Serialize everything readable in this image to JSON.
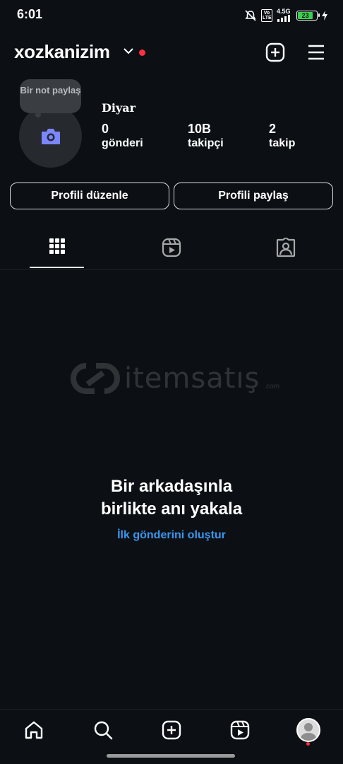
{
  "status_bar": {
    "time": "6:01",
    "network": "4.5G",
    "volte": "Vo LTE",
    "battery": "23"
  },
  "header": {
    "username": "xozkanizim",
    "icons": [
      "chevron-down-icon",
      "plus-square-icon",
      "menu-icon"
    ],
    "live_dot_color": "#ff3040"
  },
  "profile": {
    "note_bubble": "Bir not paylaş",
    "display_name": "Diyar",
    "stats": [
      {
        "value": "0",
        "label": "gönderi"
      },
      {
        "value": "10B",
        "label": "takipçi"
      },
      {
        "value": "2",
        "label": "takip"
      }
    ]
  },
  "actions": {
    "edit_profile": "Profili düzenle",
    "share_profile": "Profili paylaş"
  },
  "tabs": [
    {
      "icon": "grid-icon",
      "active": true
    },
    {
      "icon": "reels-icon",
      "active": false
    },
    {
      "icon": "tagged-icon",
      "active": false
    }
  ],
  "watermark": {
    "text": "itemsatış",
    "suffix": ".com"
  },
  "empty_state": {
    "title_line1": "Bir arkadaşınla",
    "title_line2": "birlikte anı yakala",
    "link": "İlk gönderini oluştur",
    "link_color": "#3897f0"
  },
  "bottom_nav": [
    "home-icon",
    "search-icon",
    "create-icon",
    "reels-icon",
    "profile-avatar"
  ],
  "colors": {
    "background": "#0c1014",
    "accent_red": "#ff3040",
    "battery_green": "#3ccf4e"
  }
}
